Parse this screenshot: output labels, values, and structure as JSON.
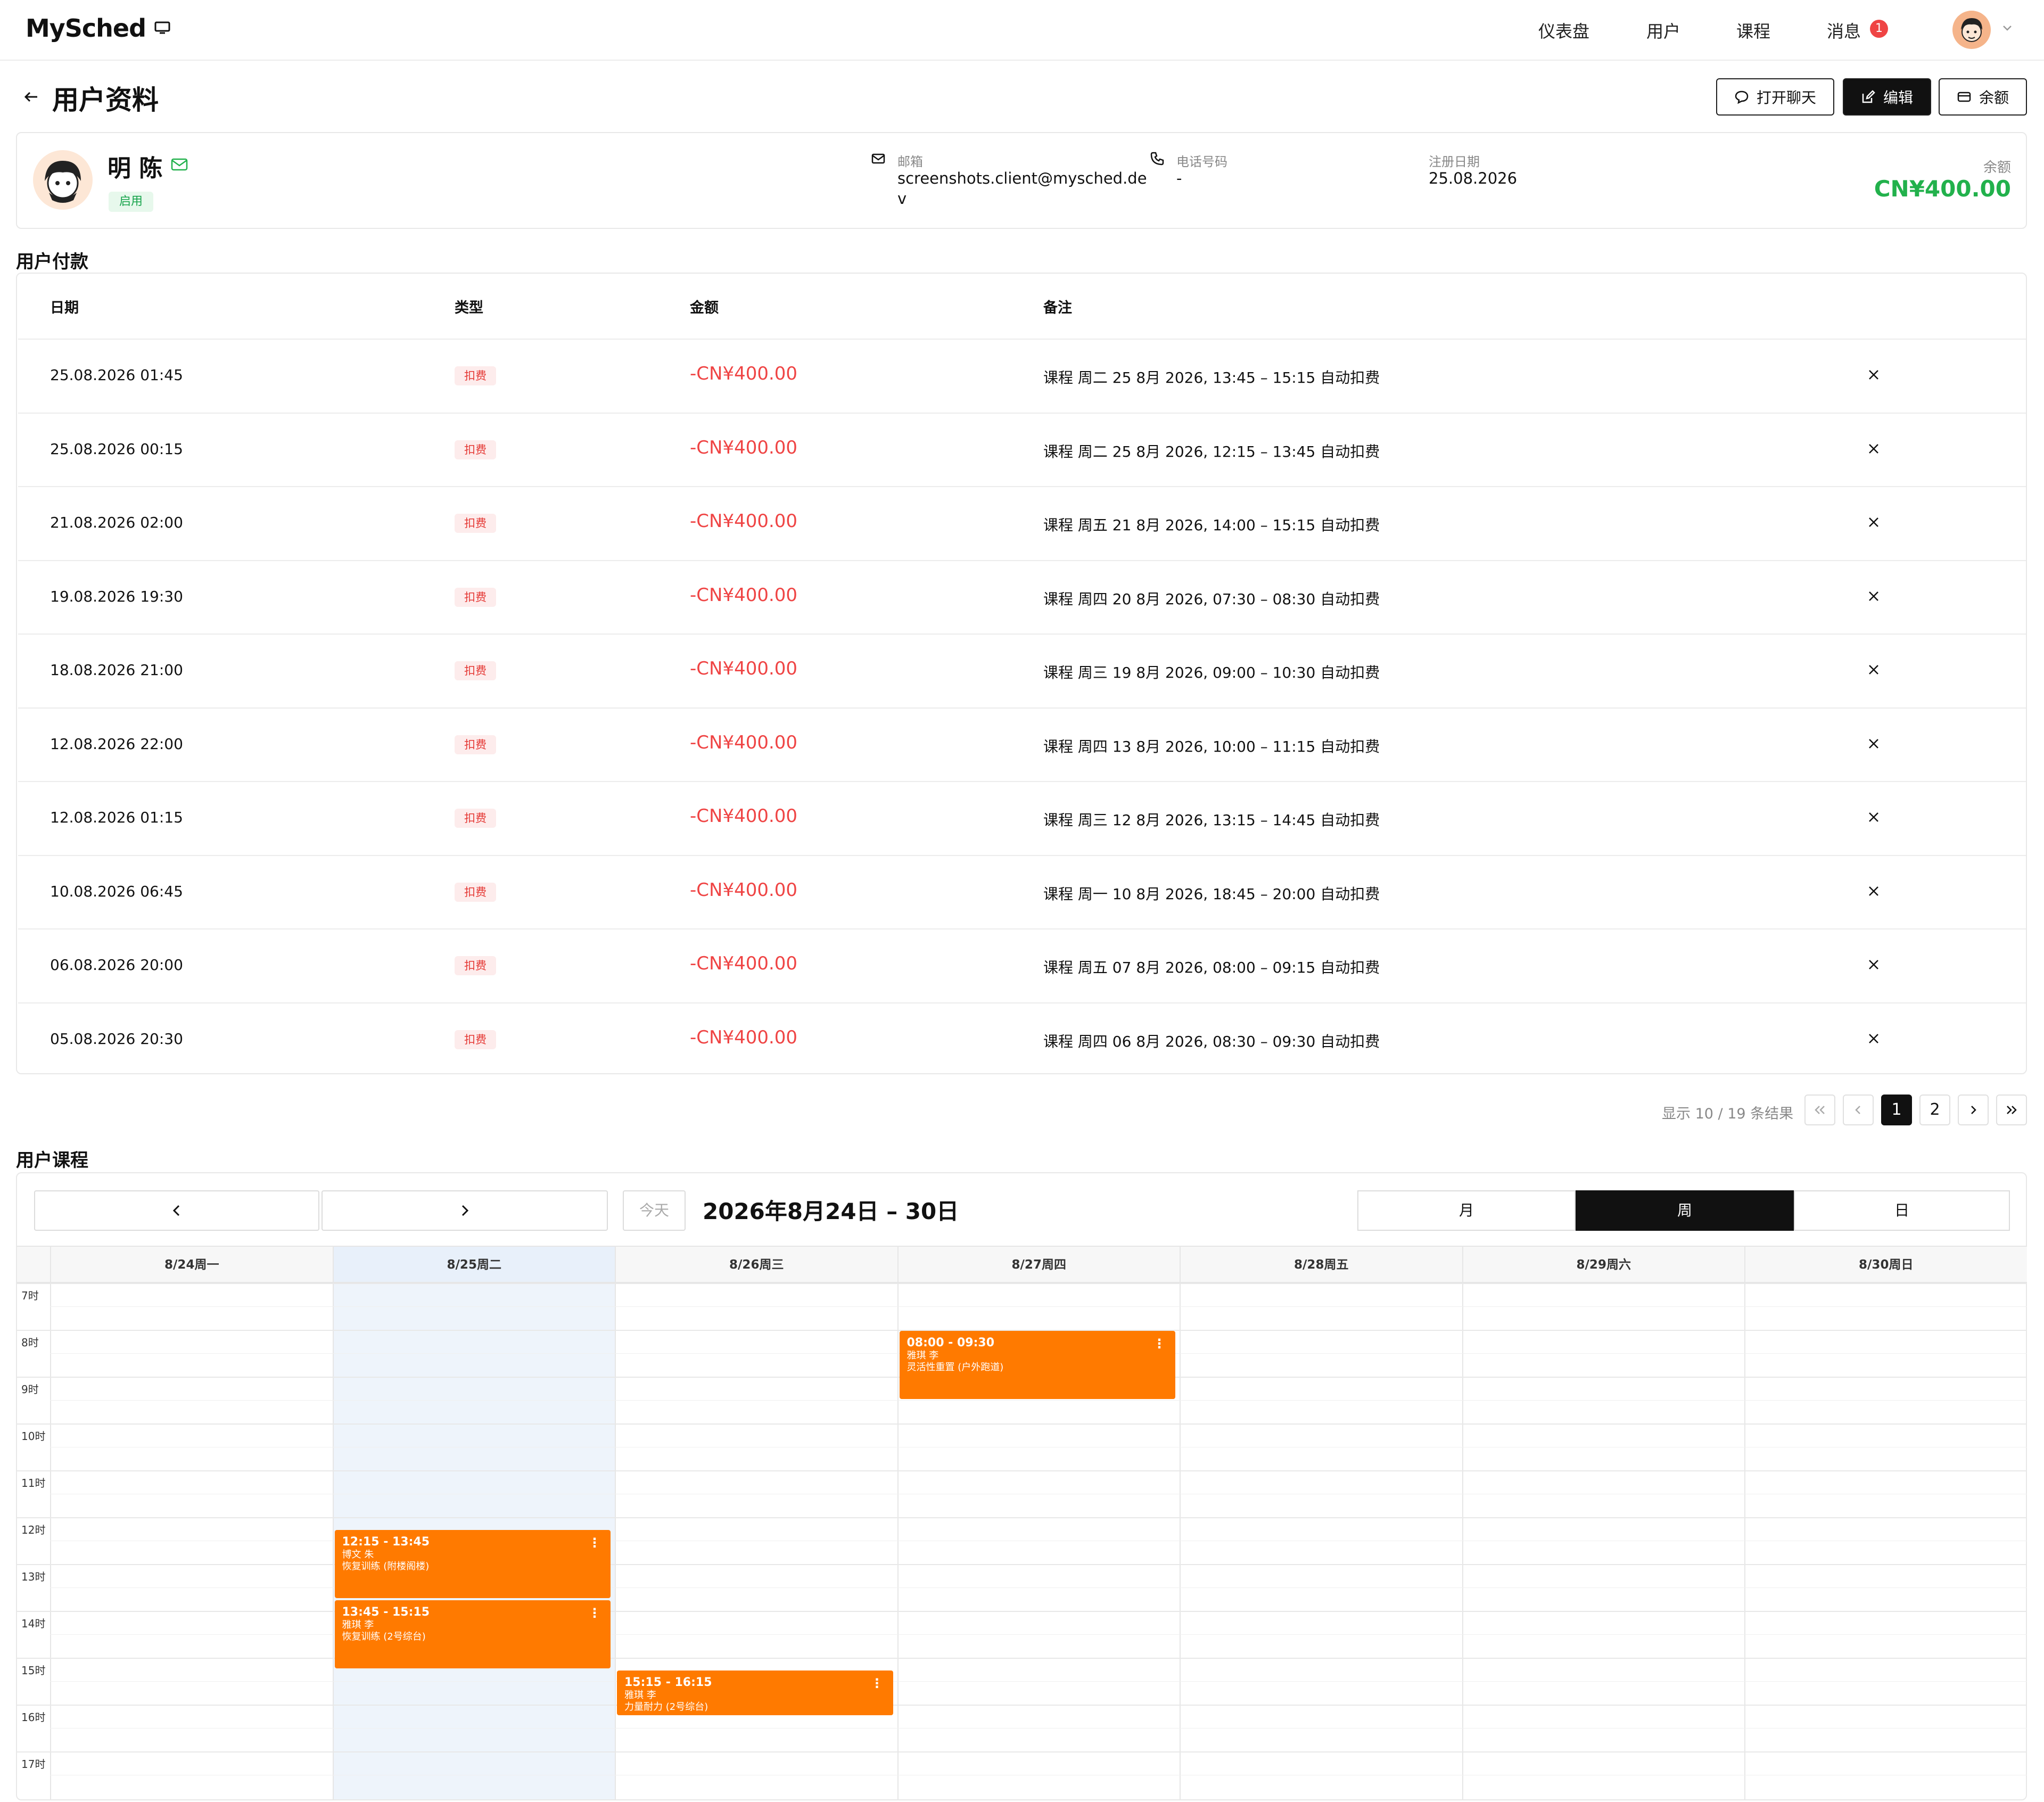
{
  "nav": {
    "logo": "MySched",
    "items": [
      "仪表盘",
      "用户",
      "课程",
      "消息"
    ],
    "message_count": "1"
  },
  "header": {
    "title": "用户资料",
    "chat_button": "打开聊天",
    "edit_button": "编辑",
    "balance_button": "余额"
  },
  "profile": {
    "name": "明 陈",
    "status": "启用",
    "email_label": "邮箱",
    "email_line1": "screenshots.client@mysched.de",
    "email_line2": "v",
    "phone_label": "电话号码",
    "phone": "-",
    "reg_label": "注册日期",
    "reg_date": "25.08.2026",
    "balance_label": "余额",
    "balance": "CN¥400.00"
  },
  "payments": {
    "title": "用户付款",
    "headers": [
      "日期",
      "类型",
      "金额",
      "备注"
    ],
    "rows": [
      {
        "date": "25.08.2026 01:45",
        "type": "扣费",
        "amount": "-CN¥400.00",
        "note": "课程 周二 25 8月 2026, 13:45 – 15:15 自动扣费"
      },
      {
        "date": "25.08.2026 00:15",
        "type": "扣费",
        "amount": "-CN¥400.00",
        "note": "课程 周二 25 8月 2026, 12:15 – 13:45 自动扣费"
      },
      {
        "date": "21.08.2026 02:00",
        "type": "扣费",
        "amount": "-CN¥400.00",
        "note": "课程 周五 21 8月 2026, 14:00 – 15:15 自动扣费"
      },
      {
        "date": "19.08.2026 19:30",
        "type": "扣费",
        "amount": "-CN¥400.00",
        "note": "课程 周四 20 8月 2026, 07:30 – 08:30 自动扣费"
      },
      {
        "date": "18.08.2026 21:00",
        "type": "扣费",
        "amount": "-CN¥400.00",
        "note": "课程 周三 19 8月 2026, 09:00 – 10:30 自动扣费"
      },
      {
        "date": "12.08.2026 22:00",
        "type": "扣费",
        "amount": "-CN¥400.00",
        "note": "课程 周四 13 8月 2026, 10:00 – 11:15 自动扣费"
      },
      {
        "date": "12.08.2026 01:15",
        "type": "扣费",
        "amount": "-CN¥400.00",
        "note": "课程 周三 12 8月 2026, 13:15 – 14:45 自动扣费"
      },
      {
        "date": "10.08.2026 06:45",
        "type": "扣费",
        "amount": "-CN¥400.00",
        "note": "课程 周一 10 8月 2026, 18:45 – 20:00 自动扣费"
      },
      {
        "date": "06.08.2026 20:00",
        "type": "扣费",
        "amount": "-CN¥400.00",
        "note": "课程 周五 07 8月 2026, 08:00 – 09:15 自动扣费"
      },
      {
        "date": "05.08.2026 20:30",
        "type": "扣费",
        "amount": "-CN¥400.00",
        "note": "课程 周四 06 8月 2026, 08:30 – 09:30 自动扣费"
      }
    ],
    "pagination": {
      "info": "显示 10 / 19 条结果",
      "pages": [
        "1",
        "2"
      ],
      "current": "1"
    }
  },
  "lessons": {
    "title": "用户课程",
    "today_button": "今天",
    "range": "2026年8月24日 – 30日",
    "views": [
      "月",
      "周",
      "日"
    ],
    "active_view": "周",
    "days": [
      "8/24周一",
      "8/25周二",
      "8/26周三",
      "8/27周四",
      "8/28周五",
      "8/29周六",
      "8/30周日"
    ],
    "today_index": 1,
    "hours": [
      "7时",
      "8时",
      "9时",
      "10时",
      "11时",
      "12时",
      "13时",
      "14时",
      "15时",
      "16时",
      "17时"
    ],
    "first_hour": 7,
    "events": [
      {
        "day": 3,
        "start": 8.0,
        "end": 9.5,
        "time": "08:00 - 09:30",
        "teacher": "雅琪 李",
        "title": "灵活性重置 (户外跑道)"
      },
      {
        "day": 1,
        "start": 12.25,
        "end": 13.75,
        "time": "12:15 - 13:45",
        "teacher": "博文 朱",
        "title": "恢复训练 (附楼阁楼)"
      },
      {
        "day": 1,
        "start": 13.75,
        "end": 15.25,
        "time": "13:45 - 15:15",
        "teacher": "雅琪 李",
        "title": "恢复训练 (2号综台)"
      },
      {
        "day": 2,
        "start": 15.25,
        "end": 16.25,
        "time": "15:15 - 16:15",
        "teacher": "雅琪 李",
        "title": "力量耐力 (2号综台)"
      }
    ]
  },
  "colors": {
    "accent": "#ff7a00",
    "positive": "#22b14c",
    "negative": "#ef4444",
    "dark": "#111111"
  }
}
